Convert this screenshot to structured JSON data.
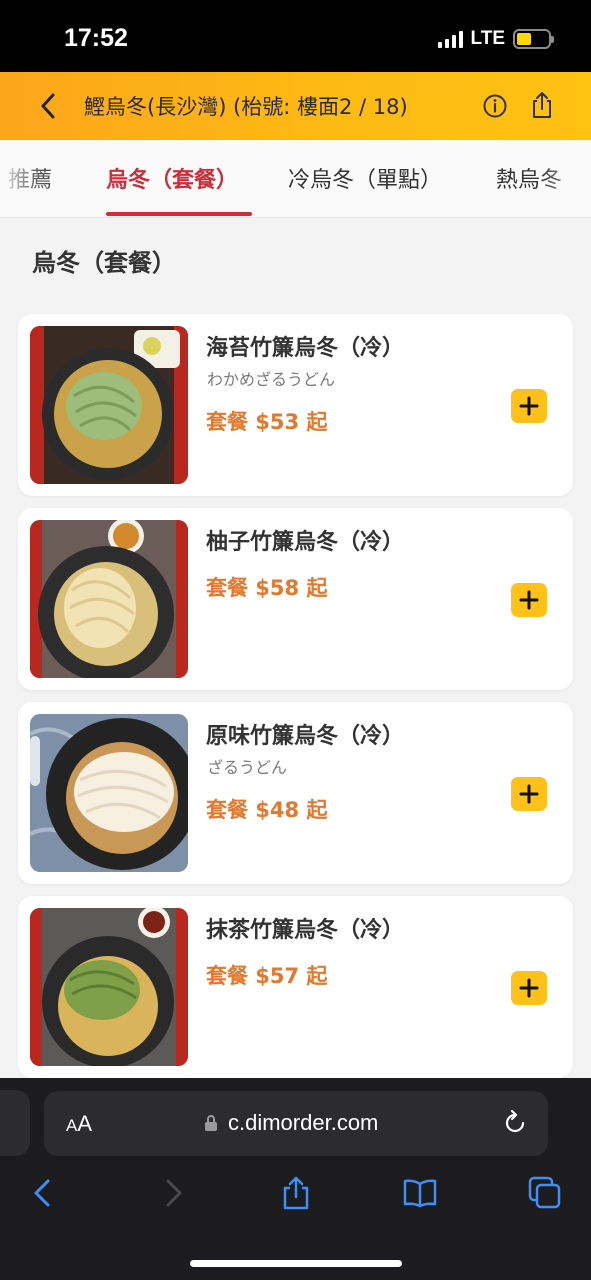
{
  "status_bar": {
    "time": "17:52",
    "network": "LTE",
    "battery_level": 0.45,
    "battery_color": "#ffd60a"
  },
  "header": {
    "title": "鰹烏冬(長沙灣) (枱號: 樓面2 / 18)",
    "back_icon": "chevron-left-icon",
    "info_icon": "info-circle-icon",
    "share_icon": "share-icon",
    "gradient_colors": [
      "#fca61b",
      "#fec211"
    ]
  },
  "tabs": [
    {
      "label": "推薦",
      "active": false
    },
    {
      "label": "烏冬（套餐）",
      "active": true
    },
    {
      "label": "冷烏冬（單點）",
      "active": false
    },
    {
      "label": "熱烏冬",
      "active": false
    }
  ],
  "accent_color": "#c8313a",
  "section_title": "烏冬（套餐）",
  "menu_items": [
    {
      "name": "海苔竹簾烏冬（冷）",
      "subtitle": "わかめざるうどん",
      "price": "套餐 $53 起",
      "noodle_color": "#9fbd7a"
    },
    {
      "name": "柚子竹簾烏冬（冷）",
      "subtitle": "",
      "price": "套餐 $58 起",
      "noodle_color": "#f1e3b4"
    },
    {
      "name": "原味竹簾烏冬（冷）",
      "subtitle": "ざるうどん",
      "price": "套餐 $48 起",
      "noodle_color": "#f7efe0"
    },
    {
      "name": "抹茶竹簾烏冬（冷）",
      "subtitle": "",
      "price": "套餐 $57 起",
      "noodle_color": "#7fa049"
    }
  ],
  "price_color": "#e2792c",
  "add_button_icon": "plus-icon",
  "browser": {
    "aa_small": "A",
    "aa_big": "A",
    "url": "c.dimorder.com",
    "nav_icons": [
      "back-icon",
      "forward-icon",
      "share-icon",
      "bookmarks-icon",
      "tabs-icon"
    ]
  }
}
